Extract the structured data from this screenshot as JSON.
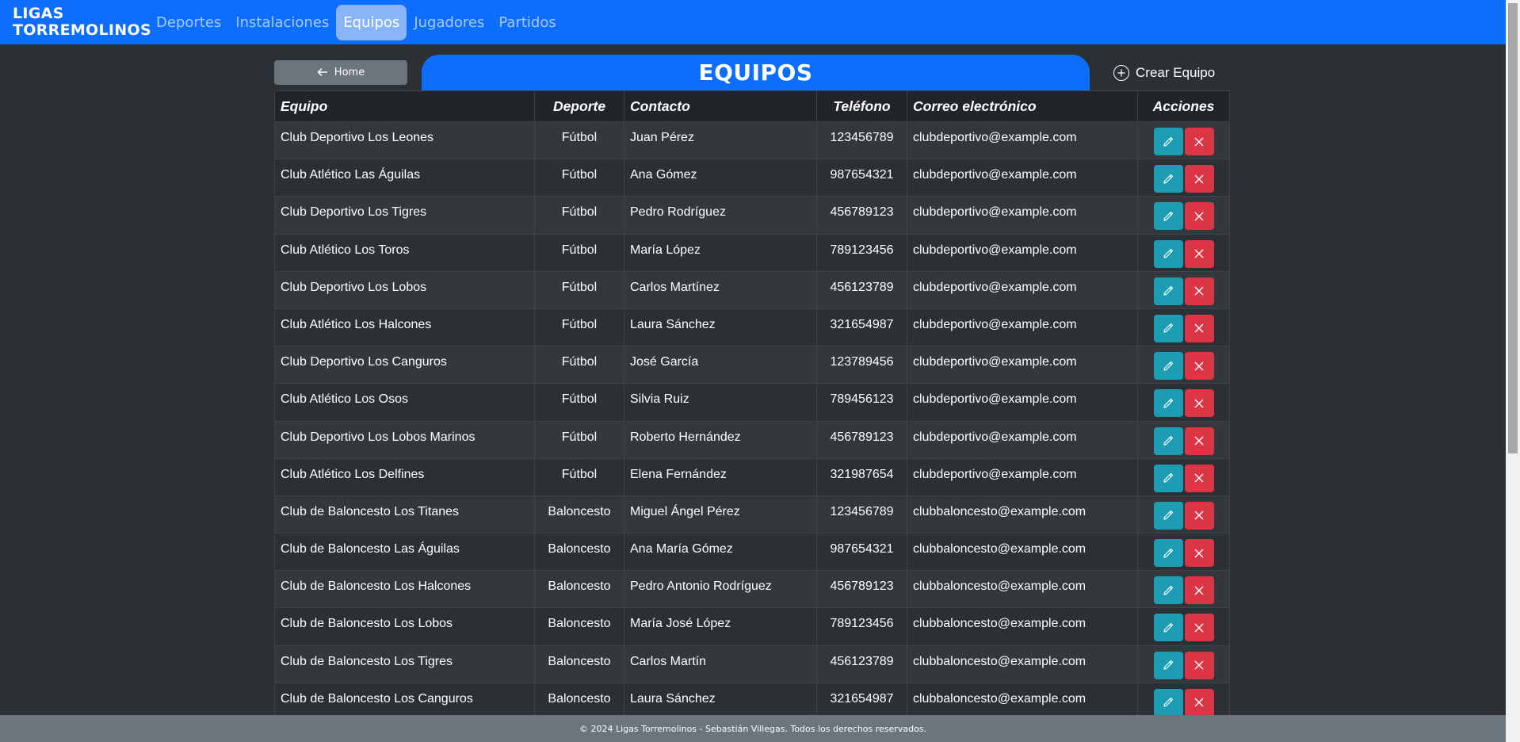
{
  "brand": {
    "line1": "LIGAS",
    "line2": "TORREMOLINOS"
  },
  "nav": {
    "items": [
      {
        "label": "Deportes"
      },
      {
        "label": "Instalaciones"
      },
      {
        "label": "Equipos"
      },
      {
        "label": "Jugadores"
      },
      {
        "label": "Partidos"
      }
    ],
    "active": "Equipos"
  },
  "header": {
    "home_label": "Home",
    "title": "EQUIPOS",
    "create_label": "Crear Equipo"
  },
  "table": {
    "columns": [
      "Equipo",
      "Deporte",
      "Contacto",
      "Teléfono",
      "Correo electrónico",
      "Acciones"
    ],
    "rows": [
      [
        "Club Deportivo Los Leones",
        "Fútbol",
        "Juan Pérez",
        "123456789",
        "clubdeportivo@example.com"
      ],
      [
        "Club Atlético Las Águilas",
        "Fútbol",
        "Ana Gómez",
        "987654321",
        "clubdeportivo@example.com"
      ],
      [
        "Club Deportivo Los Tigres",
        "Fútbol",
        "Pedro Rodríguez",
        "456789123",
        "clubdeportivo@example.com"
      ],
      [
        "Club Atlético Los Toros",
        "Fútbol",
        "María López",
        "789123456",
        "clubdeportivo@example.com"
      ],
      [
        "Club Deportivo Los Lobos",
        "Fútbol",
        "Carlos Martínez",
        "456123789",
        "clubdeportivo@example.com"
      ],
      [
        "Club Atlético Los Halcones",
        "Fútbol",
        "Laura Sánchez",
        "321654987",
        "clubdeportivo@example.com"
      ],
      [
        "Club Deportivo Los Canguros",
        "Fútbol",
        "José García",
        "123789456",
        "clubdeportivo@example.com"
      ],
      [
        "Club Atlético Los Osos",
        "Fútbol",
        "Silvia Ruiz",
        "789456123",
        "clubdeportivo@example.com"
      ],
      [
        "Club Deportivo Los Lobos Marinos",
        "Fútbol",
        "Roberto Hernández",
        "456789123",
        "clubdeportivo@example.com"
      ],
      [
        "Club Atlético Los Delfines",
        "Fútbol",
        "Elena Fernández",
        "321987654",
        "clubdeportivo@example.com"
      ],
      [
        "Club de Baloncesto Los Titanes",
        "Baloncesto",
        "Miguel Ángel Pérez",
        "123456789",
        "clubbaloncesto@example.com"
      ],
      [
        "Club de Baloncesto Las Águilas",
        "Baloncesto",
        "Ana María Gómez",
        "987654321",
        "clubbaloncesto@example.com"
      ],
      [
        "Club de Baloncesto Los Halcones",
        "Baloncesto",
        "Pedro Antonio Rodríguez",
        "456789123",
        "clubbaloncesto@example.com"
      ],
      [
        "Club de Baloncesto Los Lobos",
        "Baloncesto",
        "María José López",
        "789123456",
        "clubbaloncesto@example.com"
      ],
      [
        "Club de Baloncesto Los Tigres",
        "Baloncesto",
        "Carlos Martín",
        "456123789",
        "clubbaloncesto@example.com"
      ],
      [
        "Club de Baloncesto Los Canguros",
        "Baloncesto",
        "Laura Sánchez",
        "321654987",
        "clubbaloncesto@example.com"
      ]
    ]
  },
  "footer": {
    "text": "© 2024 Ligas Torremolinos - Sebastián Villegas. Todos los derechos reservados."
  },
  "icons": {
    "home": "arrow-left-icon",
    "create": "plus-circle-icon",
    "edit": "pencil-icon",
    "delete": "x-icon"
  },
  "colors": {
    "primary": "#0d6efd",
    "background": "#2b3035",
    "edit": "#1d9db3",
    "delete": "#dc3545",
    "footer": "#6c757d"
  }
}
